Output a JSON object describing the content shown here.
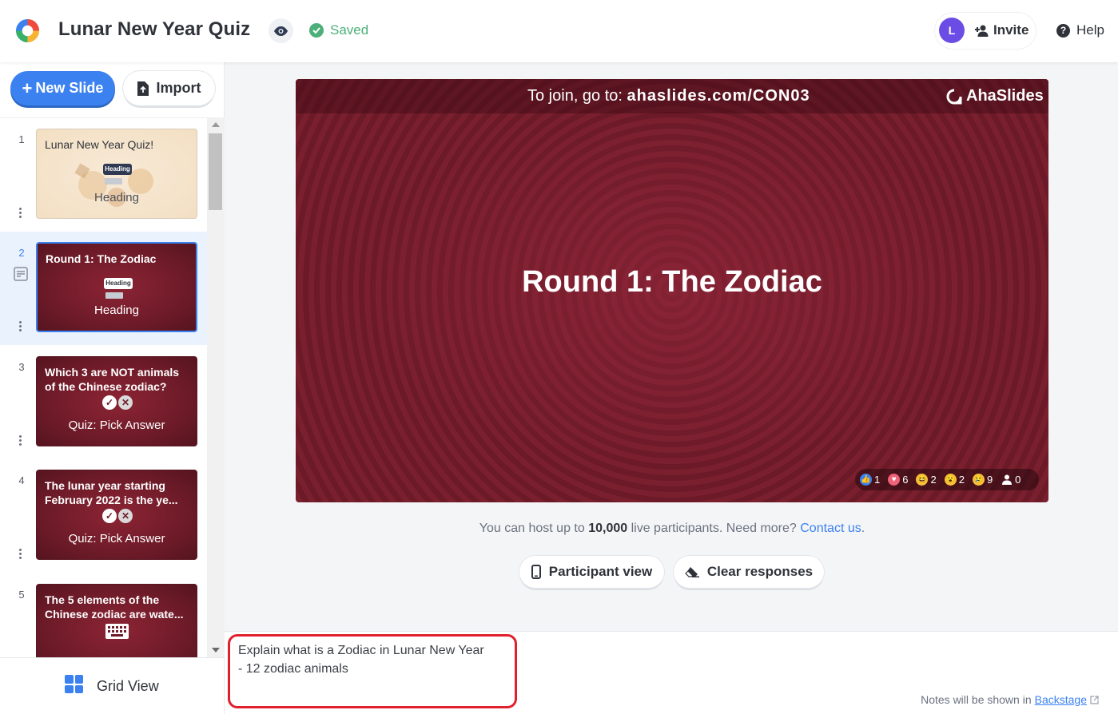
{
  "header": {
    "title": "Lunar New Year Quiz",
    "saved_label": "Saved",
    "avatar_initial": "L",
    "invite_label": "Invite",
    "help_label": "Help"
  },
  "sidebar": {
    "new_slide_label": "New Slide",
    "import_label": "Import",
    "grid_view_label": "Grid View",
    "slides": [
      {
        "num": "1",
        "title": "Lunar New Year Quiz!",
        "badge": "Heading",
        "type": "Heading",
        "theme": "cream"
      },
      {
        "num": "2",
        "title": "Round 1: The Zodiac",
        "badge": "Heading",
        "type": "Heading",
        "theme": "red"
      },
      {
        "num": "3",
        "title": "Which 3 are NOT animals of the Chinese zodiac?",
        "type": "Quiz: Pick Answer",
        "theme": "red"
      },
      {
        "num": "4",
        "title": "The lunar year starting February 2022 is the ye...",
        "type": "Quiz: Pick Answer",
        "theme": "red"
      },
      {
        "num": "5",
        "title": "The 5 elements of the Chinese zodiac are wate...",
        "type": "Quiz: Type Answer",
        "theme": "red"
      }
    ]
  },
  "slide": {
    "join_prefix": "To join, go to: ",
    "join_url": "ahaslides.com/CON03",
    "brand": "AhaSlides",
    "heading": "Round 1: The Zodiac",
    "reactions": {
      "like": "1",
      "heart": "6",
      "laugh": "2",
      "wow": "2",
      "sad": "9",
      "participants": "0"
    }
  },
  "main": {
    "info_prefix": "You can host up to ",
    "info_bold": "10,000",
    "info_suffix": " live participants. Need more? ",
    "contact_link": "Contact us",
    "info_end": ".",
    "participant_view_label": "Participant view",
    "clear_responses_label": "Clear responses"
  },
  "notes": {
    "text": "Explain what is a Zodiac in Lunar New Year\n- 12 zodiac animals",
    "hint_prefix": "Notes will be shown in ",
    "hint_link": "Backstage"
  },
  "colors": {
    "accent": "#3b82f0",
    "saved": "#4caf7a",
    "slide_bg": "#6c1a28",
    "highlight": "#e0202c",
    "avatar": "#6b4de6"
  }
}
